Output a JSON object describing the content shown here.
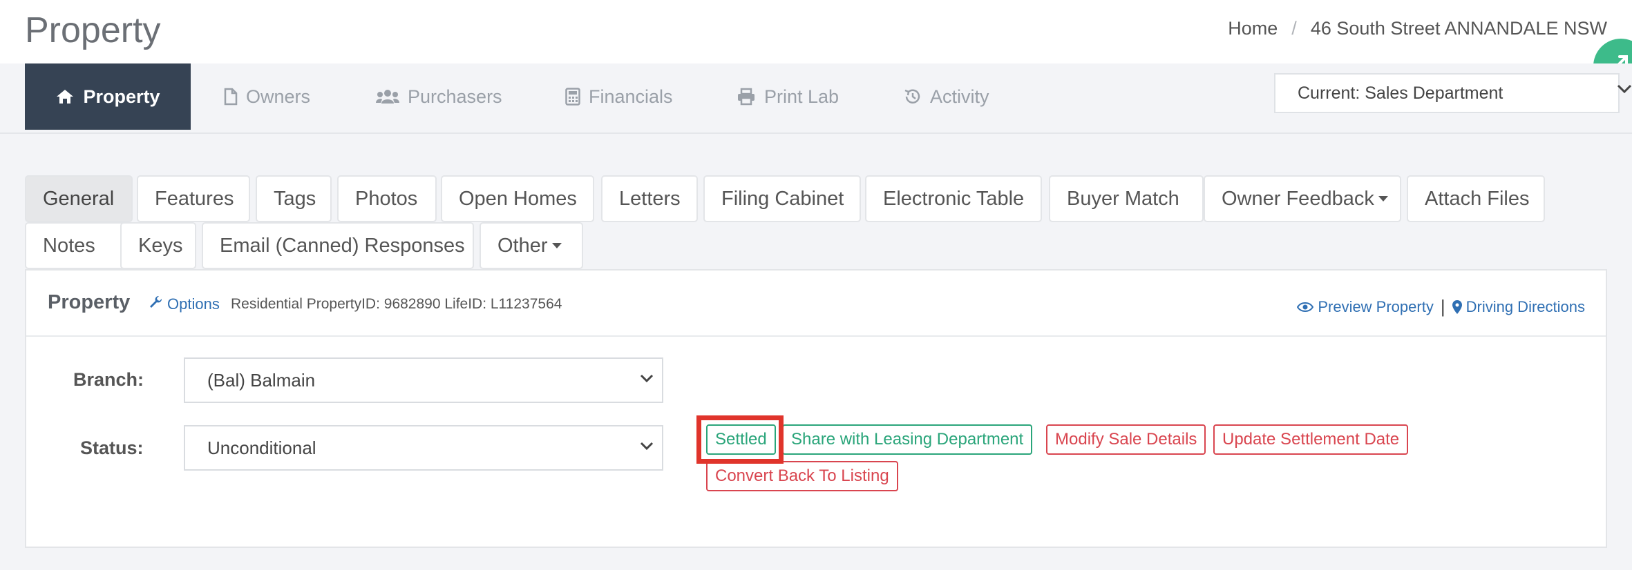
{
  "header": {
    "title": "Property",
    "breadcrumb": {
      "home": "Home",
      "separator": "/",
      "current": "46 South Street ANNANDALE NSW"
    }
  },
  "nav": {
    "tabs": [
      {
        "label": "Property",
        "icon": "home-icon",
        "active": true
      },
      {
        "label": "Owners",
        "icon": "file-icon",
        "active": false
      },
      {
        "label": "Purchasers",
        "icon": "users-icon",
        "active": false
      },
      {
        "label": "Financials",
        "icon": "calculator-icon",
        "active": false
      },
      {
        "label": "Print Lab",
        "icon": "print-icon",
        "active": false
      },
      {
        "label": "Activity",
        "icon": "history-icon",
        "active": false
      }
    ],
    "department": "Current: Sales Department"
  },
  "subtabs": [
    {
      "label": "General",
      "active": true
    },
    {
      "label": "Features"
    },
    {
      "label": "Tags"
    },
    {
      "label": "Photos"
    },
    {
      "label": "Open Homes"
    },
    {
      "label": "Letters"
    },
    {
      "label": "Filing Cabinet"
    },
    {
      "label": "Electronic Table"
    },
    {
      "label": "Buyer Match"
    },
    {
      "label": "Owner Feedback",
      "dropdown": true
    },
    {
      "label": "Attach Files"
    },
    {
      "label": "Notes"
    },
    {
      "label": "Keys"
    },
    {
      "label": "Email (Canned) Responses"
    },
    {
      "label": "Other",
      "dropdown": true
    }
  ],
  "panel": {
    "title": "Property",
    "options_label": "Options",
    "meta": "Residential PropertyID: 9682890  LifeID: L11237564",
    "preview_label": "Preview Property",
    "divider": "|",
    "directions_label": "Driving Directions"
  },
  "form": {
    "branch_label": "Branch:",
    "branch_value": "(Bal) Balmain",
    "status_label": "Status:",
    "status_value": "Unconditional"
  },
  "actions": [
    {
      "label": "Settled",
      "color": "#2aa57a"
    },
    {
      "label": "Share with Leasing Department",
      "color": "#2aa57a"
    },
    {
      "label": "Modify Sale Details",
      "color": "#d9454f"
    },
    {
      "label": "Update Settlement Date",
      "color": "#d9454f"
    },
    {
      "label": "Convert Back To Listing",
      "color": "#d9454f"
    }
  ],
  "colors": {
    "nav_active": "#364354",
    "link": "#2f6fb3",
    "green": "#2aa57a",
    "red": "#d9454f",
    "highlight": "#e0342b"
  }
}
